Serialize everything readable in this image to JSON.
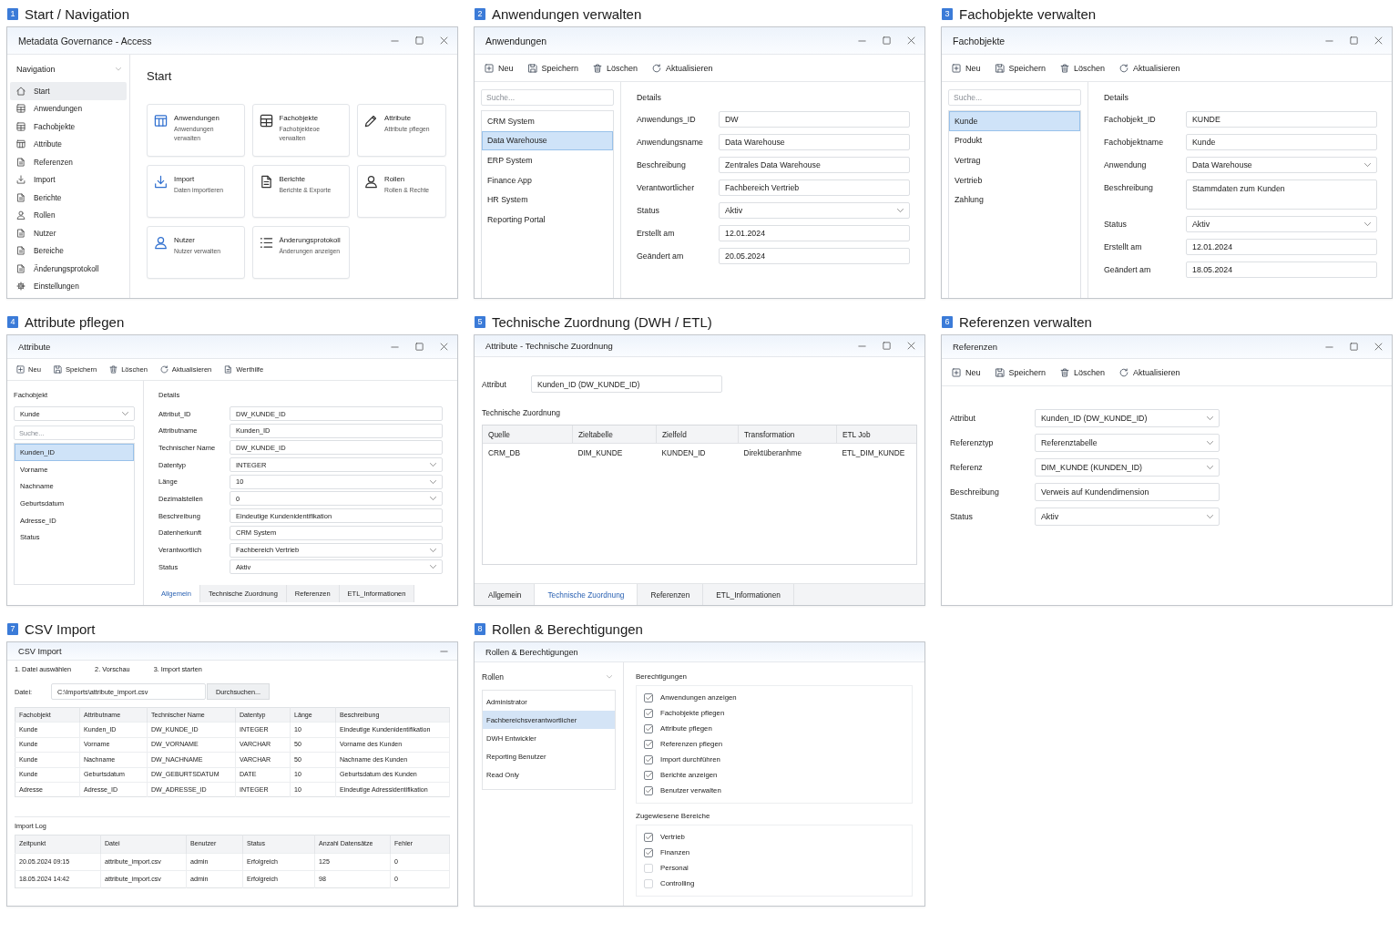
{
  "sections": [
    {
      "kind": "start",
      "number": "1",
      "heading": "Start / Navigation",
      "window": {
        "title": "Metadata Governance - Access",
        "controls": {
          "minimize": true,
          "maximize": true,
          "close": true
        }
      },
      "navigation": {
        "title": "Navigation",
        "items": [
          {
            "label": "Start",
            "selected": true
          },
          {
            "label": "Anwendungen",
            "selected": false
          },
          {
            "label": "Fachobjekte",
            "selected": false
          },
          {
            "label": "Attribute",
            "selected": false
          },
          {
            "label": "Referenzen",
            "selected": false
          },
          {
            "label": "Import",
            "selected": false
          },
          {
            "label": "Berichte",
            "selected": false
          },
          {
            "label": "Rollen",
            "selected": false
          },
          {
            "label": "Nutzer",
            "selected": false
          },
          {
            "label": "Bereiche",
            "selected": false
          },
          {
            "label": "Änderungsprotokoll",
            "selected": false
          },
          {
            "label": "Einstellungen",
            "selected": false
          }
        ]
      },
      "content": {
        "title": "Start",
        "tiles": [
          {
            "title": "Anwendungen",
            "description": "Anwendungen verwalten"
          },
          {
            "title": "Fachobjekte",
            "description": "Fachobjekteoe verwalten"
          },
          {
            "title": "Attribute",
            "description": "Attribute pflegen"
          },
          {
            "title": "Import",
            "description": "Daten importieren"
          },
          {
            "title": "Berichte",
            "description": "Berichte & Exporte"
          },
          {
            "title": "Rollen",
            "description": "Rollen & Rechte"
          },
          {
            "title": "Nutzer",
            "description": "Nutzer verwalten"
          },
          {
            "title": "Änderungsprotokoll",
            "description": "Änderungen anzeigen"
          }
        ]
      }
    },
    {
      "kind": "master_detail",
      "number": "2",
      "heading": "Anwendungen verwalten",
      "window": {
        "title": "Anwendungen",
        "controls": {
          "minimize": true,
          "maximize": true,
          "close": true
        }
      },
      "toolbar": [
        "Neu",
        "Speichern",
        "Löschen",
        "Aktualisieren"
      ],
      "search": {
        "placeholder": "Suche..."
      },
      "list": [
        {
          "label": "CRM System",
          "selected": false
        },
        {
          "label": "Data Warehouse",
          "selected": true
        },
        {
          "label": "ERP System",
          "selected": false
        },
        {
          "label": "Finance App",
          "selected": false
        },
        {
          "label": "HR System",
          "selected": false
        },
        {
          "label": "Reporting Portal",
          "selected": false
        }
      ],
      "details": {
        "title": "Details",
        "fields": [
          {
            "label": "Anwendungs_ID",
            "value": "DW",
            "kind": "text"
          },
          {
            "label": "Anwendungsname",
            "value": "Data Warehouse",
            "kind": "text"
          },
          {
            "label": "Beschreibung",
            "value": "Zentrales Data Warehouse",
            "kind": "text"
          },
          {
            "label": "Verantwortlicher",
            "value": "Fachbereich Vertrieb",
            "kind": "text"
          },
          {
            "label": "Status",
            "value": "Aktiv",
            "kind": "select"
          },
          {
            "label": "Erstellt am",
            "value": "12.01.2024",
            "kind": "text"
          },
          {
            "label": "Geändert am",
            "value": "20.05.2024",
            "kind": "text"
          }
        ]
      }
    },
    {
      "kind": "master_detail",
      "number": "3",
      "heading": "Fachobjekte verwalten",
      "window": {
        "title": "Fachobjekte",
        "controls": {
          "minimize": true,
          "maximize": true,
          "close": true
        }
      },
      "toolbar": [
        "Neu",
        "Speichern",
        "Löschen",
        "Aktualisieren"
      ],
      "search": {
        "placeholder": "Suche..."
      },
      "list": [
        {
          "label": "Kunde",
          "selected": true
        },
        {
          "label": "Produkt",
          "selected": false
        },
        {
          "label": "Vertrag",
          "selected": false
        },
        {
          "label": "Vertrieb",
          "selected": false
        },
        {
          "label": "Zahlung",
          "selected": false
        }
      ],
      "details": {
        "title": "Details",
        "fields": [
          {
            "label": "Fachobjekt_ID",
            "value": "KUNDE",
            "kind": "text"
          },
          {
            "label": "Fachobjektname",
            "value": "Kunde",
            "kind": "text"
          },
          {
            "label": "Anwendung",
            "value": "Data Warehouse",
            "kind": "select"
          },
          {
            "label": "Beschreibung",
            "value": "Stammdaten zum Kunden",
            "kind": "textarea"
          },
          {
            "label": "Status",
            "value": "Aktiv",
            "kind": "select"
          },
          {
            "label": "Erstellt am",
            "value": "12.01.2024",
            "kind": "text"
          },
          {
            "label": "Geändert am",
            "value": "18.05.2024",
            "kind": "text"
          }
        ]
      }
    },
    {
      "kind": "attribute_editor",
      "number": "4",
      "heading": "Attribute pflegen",
      "window": {
        "title": "Attribute",
        "controls": {
          "minimize": true,
          "maximize": true,
          "close": true
        }
      },
      "toolbar": [
        "Neu",
        "Speichern",
        "Löschen",
        "Aktualisieren",
        "Werthilfe"
      ],
      "filter": {
        "label": "Fachobjekt",
        "value": "Kunde"
      },
      "search": {
        "placeholder": "Suche..."
      },
      "list": [
        {
          "label": "Kunden_ID",
          "selected": true
        },
        {
          "label": "Vorname",
          "selected": false
        },
        {
          "label": "Nachname",
          "selected": false
        },
        {
          "label": "Geburtsdatum",
          "selected": false
        },
        {
          "label": "Adresse_ID",
          "selected": false
        },
        {
          "label": "Status",
          "selected": false
        }
      ],
      "details": {
        "title": "Details",
        "fields": [
          {
            "label": "Attribut_ID",
            "value": "DW_KUNDE_ID",
            "kind": "text"
          },
          {
            "label": "Attributname",
            "value": "Kunden_ID",
            "kind": "text"
          },
          {
            "label": "Technischer Name",
            "value": "DW_KUNDE_ID",
            "kind": "text"
          },
          {
            "label": "Datentyp",
            "value": "INTEGER",
            "kind": "select"
          },
          {
            "label": "Länge",
            "value": "10",
            "kind": "select"
          },
          {
            "label": "Dezimalstellen",
            "value": "0",
            "kind": "select"
          },
          {
            "label": "Beschreibung",
            "value": "Eindeutige Kundenidentifikation",
            "kind": "text"
          },
          {
            "label": "Datenherkunft",
            "value": "CRM System",
            "kind": "text"
          },
          {
            "label": "Verantwortlich",
            "value": "Fachbereich Vertrieb",
            "kind": "select"
          },
          {
            "label": "Status",
            "value": "Aktiv",
            "kind": "select"
          }
        ]
      },
      "tabs": [
        {
          "label": "Allgemein",
          "selected": true
        },
        {
          "label": "Technische Zuordnung",
          "selected": false
        },
        {
          "label": "Referenzen",
          "selected": false
        },
        {
          "label": "ETL_Informationen",
          "selected": false
        }
      ]
    },
    {
      "kind": "mapping",
      "number": "5",
      "heading": "Technische Zuordnung (DWH / ETL)",
      "window": {
        "title": "Attribute - Technische Zuordnung",
        "controls": {
          "minimize": true,
          "maximize": true,
          "close": true
        }
      },
      "attribute": {
        "label": "Attribut",
        "value": "Kunden_ID (DW_KUNDE_ID)"
      },
      "table": {
        "title": "Technische Zuordnung",
        "columns": [
          "Quelle",
          "Zieltabelle",
          "Zielfeld",
          "Transformation",
          "ETL Job"
        ],
        "rows": [
          [
            "CRM_DB",
            "DIM_KUNDE",
            "KUNDEN_ID",
            "Direktüberanhme",
            "ETL_DIM_KUNDE"
          ]
        ]
      },
      "tabs": [
        {
          "label": "Allgemein",
          "selected": false
        },
        {
          "label": "Technische Zuordnung",
          "selected": true
        },
        {
          "label": "Referenzen",
          "selected": false
        },
        {
          "label": "ETL_Informationen",
          "selected": false
        }
      ]
    },
    {
      "kind": "form",
      "number": "6",
      "heading": "Referenzen verwalten",
      "window": {
        "title": "Referenzen",
        "controls": {
          "minimize": true,
          "maximize": true,
          "close": true
        }
      },
      "toolbar": [
        "Neu",
        "Speichern",
        "Löschen",
        "Aktualisieren"
      ],
      "fields": [
        {
          "label": "Attribut",
          "value": "Kunden_ID (DW_KUNDE_ID)",
          "kind": "select"
        },
        {
          "label": "Referenztyp",
          "value": "Referenztabelle",
          "kind": "select"
        },
        {
          "label": "Referenz",
          "value": "DIM_KUNDE (KUNDEN_ID)",
          "kind": "select"
        },
        {
          "label": "Beschreibung",
          "value": "Verweis auf Kundendimension",
          "kind": "text"
        },
        {
          "label": "Status",
          "value": "Aktiv",
          "kind": "select"
        }
      ]
    },
    {
      "kind": "import",
      "number": "7",
      "heading": "CSV Import",
      "window": {
        "title": "CSV Import",
        "controls": {
          "minimize": true
        }
      },
      "steps": [
        "1. Datei auswählen",
        "2. Vorschau",
        "3. Import starten"
      ],
      "file": {
        "label": "Datei:",
        "value": "C:\\Imports\\attribute_import.csv",
        "button": "Durchsuchen..."
      },
      "preview": {
        "columns": [
          "Fachobjekt",
          "Attributname",
          "Technischer Name",
          "Datentyp",
          "Länge",
          "Beschreibung"
        ],
        "rows": [
          [
            "Kunde",
            "Kunden_ID",
            "DW_KUNDE_ID",
            "INTEGER",
            "10",
            "Eindeutige Kundenidentifikation"
          ],
          [
            "Kunde",
            "Vorname",
            "DW_VORNAME",
            "VARCHAR",
            "50",
            "Vorname des Kunden"
          ],
          [
            "Kunde",
            "Nachname",
            "DW_NACHNAME",
            "VARCHAR",
            "50",
            "Nachname des Kunden"
          ],
          [
            "Kunde",
            "Geburtsdatum",
            "DW_GEBURTSDATUM",
            "DATE",
            "10",
            "Geburtsdatum des Kunden"
          ],
          [
            "Adresse",
            "Adresse_ID",
            "DW_ADRESSE_ID",
            "INTEGER",
            "10",
            "Eindeutige Adressidentifikation"
          ]
        ]
      },
      "log": {
        "title": "Import Log",
        "columns": [
          "Zeitpunkt",
          "Datei",
          "Benutzer",
          "Status",
          "Anzahl Datensätze",
          "Fehler"
        ],
        "rows": [
          [
            "20.05.2024 09:15",
            "attribute_import.csv",
            "admin",
            "Erfolgreich",
            "125",
            "0"
          ],
          [
            "18.05.2024 14:42",
            "attribute_import.csv",
            "admin",
            "Erfolgreich",
            "98",
            "0"
          ]
        ]
      }
    },
    {
      "kind": "roles",
      "number": "8",
      "heading": "Rollen & Berechtigungen",
      "window": {
        "title": "Rollen & Berechtigungen"
      },
      "roles": {
        "title": "Rollen",
        "items": [
          {
            "label": "Administrator",
            "selected": false
          },
          {
            "label": "Fachbereichsverantwortlicher",
            "selected": true
          },
          {
            "label": "DWH Entwickler",
            "selected": false
          },
          {
            "label": "Reporting Benutzer",
            "selected": false
          },
          {
            "label": "Read Only",
            "selected": false
          }
        ]
      },
      "permissions": {
        "title": "Berechtigungen",
        "items": [
          {
            "label": "Anwendungen anzeigen",
            "checked": true
          },
          {
            "label": "Fachobjekte pflegen",
            "checked": true
          },
          {
            "label": "Attribute pflegen",
            "checked": true
          },
          {
            "label": "Referenzen pflegen",
            "checked": true
          },
          {
            "label": "Import durchführen",
            "checked": true
          },
          {
            "label": "Berichte anzeigen",
            "checked": true
          },
          {
            "label": "Benutzer verwalten",
            "checked": true
          }
        ]
      },
      "areas": {
        "title": "Zugewiesene Bereiche",
        "items": [
          {
            "label": "Vertrieb",
            "checked": true
          },
          {
            "label": "Finanzen",
            "checked": true
          },
          {
            "label": "Personal",
            "checked": false
          },
          {
            "label": "Controlling",
            "checked": false
          }
        ]
      }
    }
  ]
}
